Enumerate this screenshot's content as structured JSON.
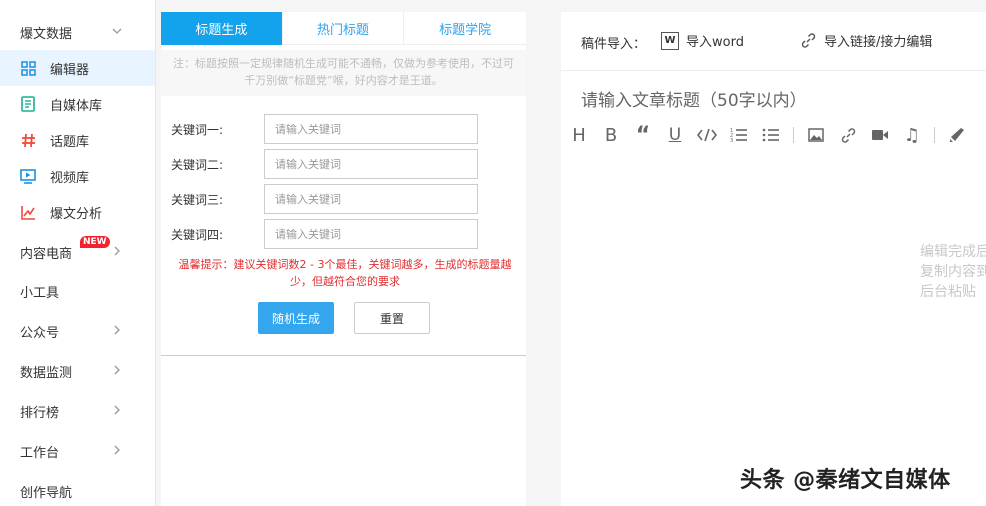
{
  "sidebar": {
    "group_title": "爆文数据",
    "items": [
      {
        "label": "编辑器",
        "icon": "grid-icon"
      },
      {
        "label": "自媒体库",
        "icon": "document-icon"
      },
      {
        "label": "话题库",
        "icon": "hashtag-icon"
      },
      {
        "label": "视频库",
        "icon": "video-icon"
      },
      {
        "label": "爆文分析",
        "icon": "chart-icon"
      }
    ],
    "sections": [
      {
        "label": "内容电商",
        "badge": "NEW"
      },
      {
        "label": "小工具"
      },
      {
        "label": "公众号"
      },
      {
        "label": "数据监测"
      },
      {
        "label": "排行榜"
      },
      {
        "label": "工作台"
      },
      {
        "label": "创作导航"
      }
    ]
  },
  "title_panel": {
    "tabs": [
      "标题生成",
      "热门标题",
      "标题学院"
    ],
    "notice": "注：标题按照一定规律随机生成可能不通畅，仅做为参考使用，不过可千万别做“标题党”喉，好内容才是王道。",
    "keywords": [
      {
        "label": "关键词一:",
        "placeholder": "请输入关键词"
      },
      {
        "label": "关键词二:",
        "placeholder": "请输入关键词"
      },
      {
        "label": "关键词三:",
        "placeholder": "请输入关键词"
      },
      {
        "label": "关键词四:",
        "placeholder": "请输入关键词"
      }
    ],
    "tip": "温馨提示：建议关键词数2 - 3个最佳，关键词越多，生成的标题量越少，但越符合您的要求",
    "generate_button": "随机生成",
    "reset_button": "重置"
  },
  "editor": {
    "import_label": "稿件导入：",
    "word_icon_text": "W",
    "import_word": "导入word",
    "import_link": "导入链接/接力编辑",
    "title_placeholder": "请输入文章标题（50字以内）",
    "hint_lines": [
      "编辑完成后",
      "复制内容到",
      "后台粘贴"
    ]
  },
  "watermark": "头条 @秦绪文自媒体",
  "colors": {
    "accent": "#12a3ec",
    "button": "#33a6ee",
    "warning": "#e02e2e",
    "badge": "#f5222d"
  }
}
